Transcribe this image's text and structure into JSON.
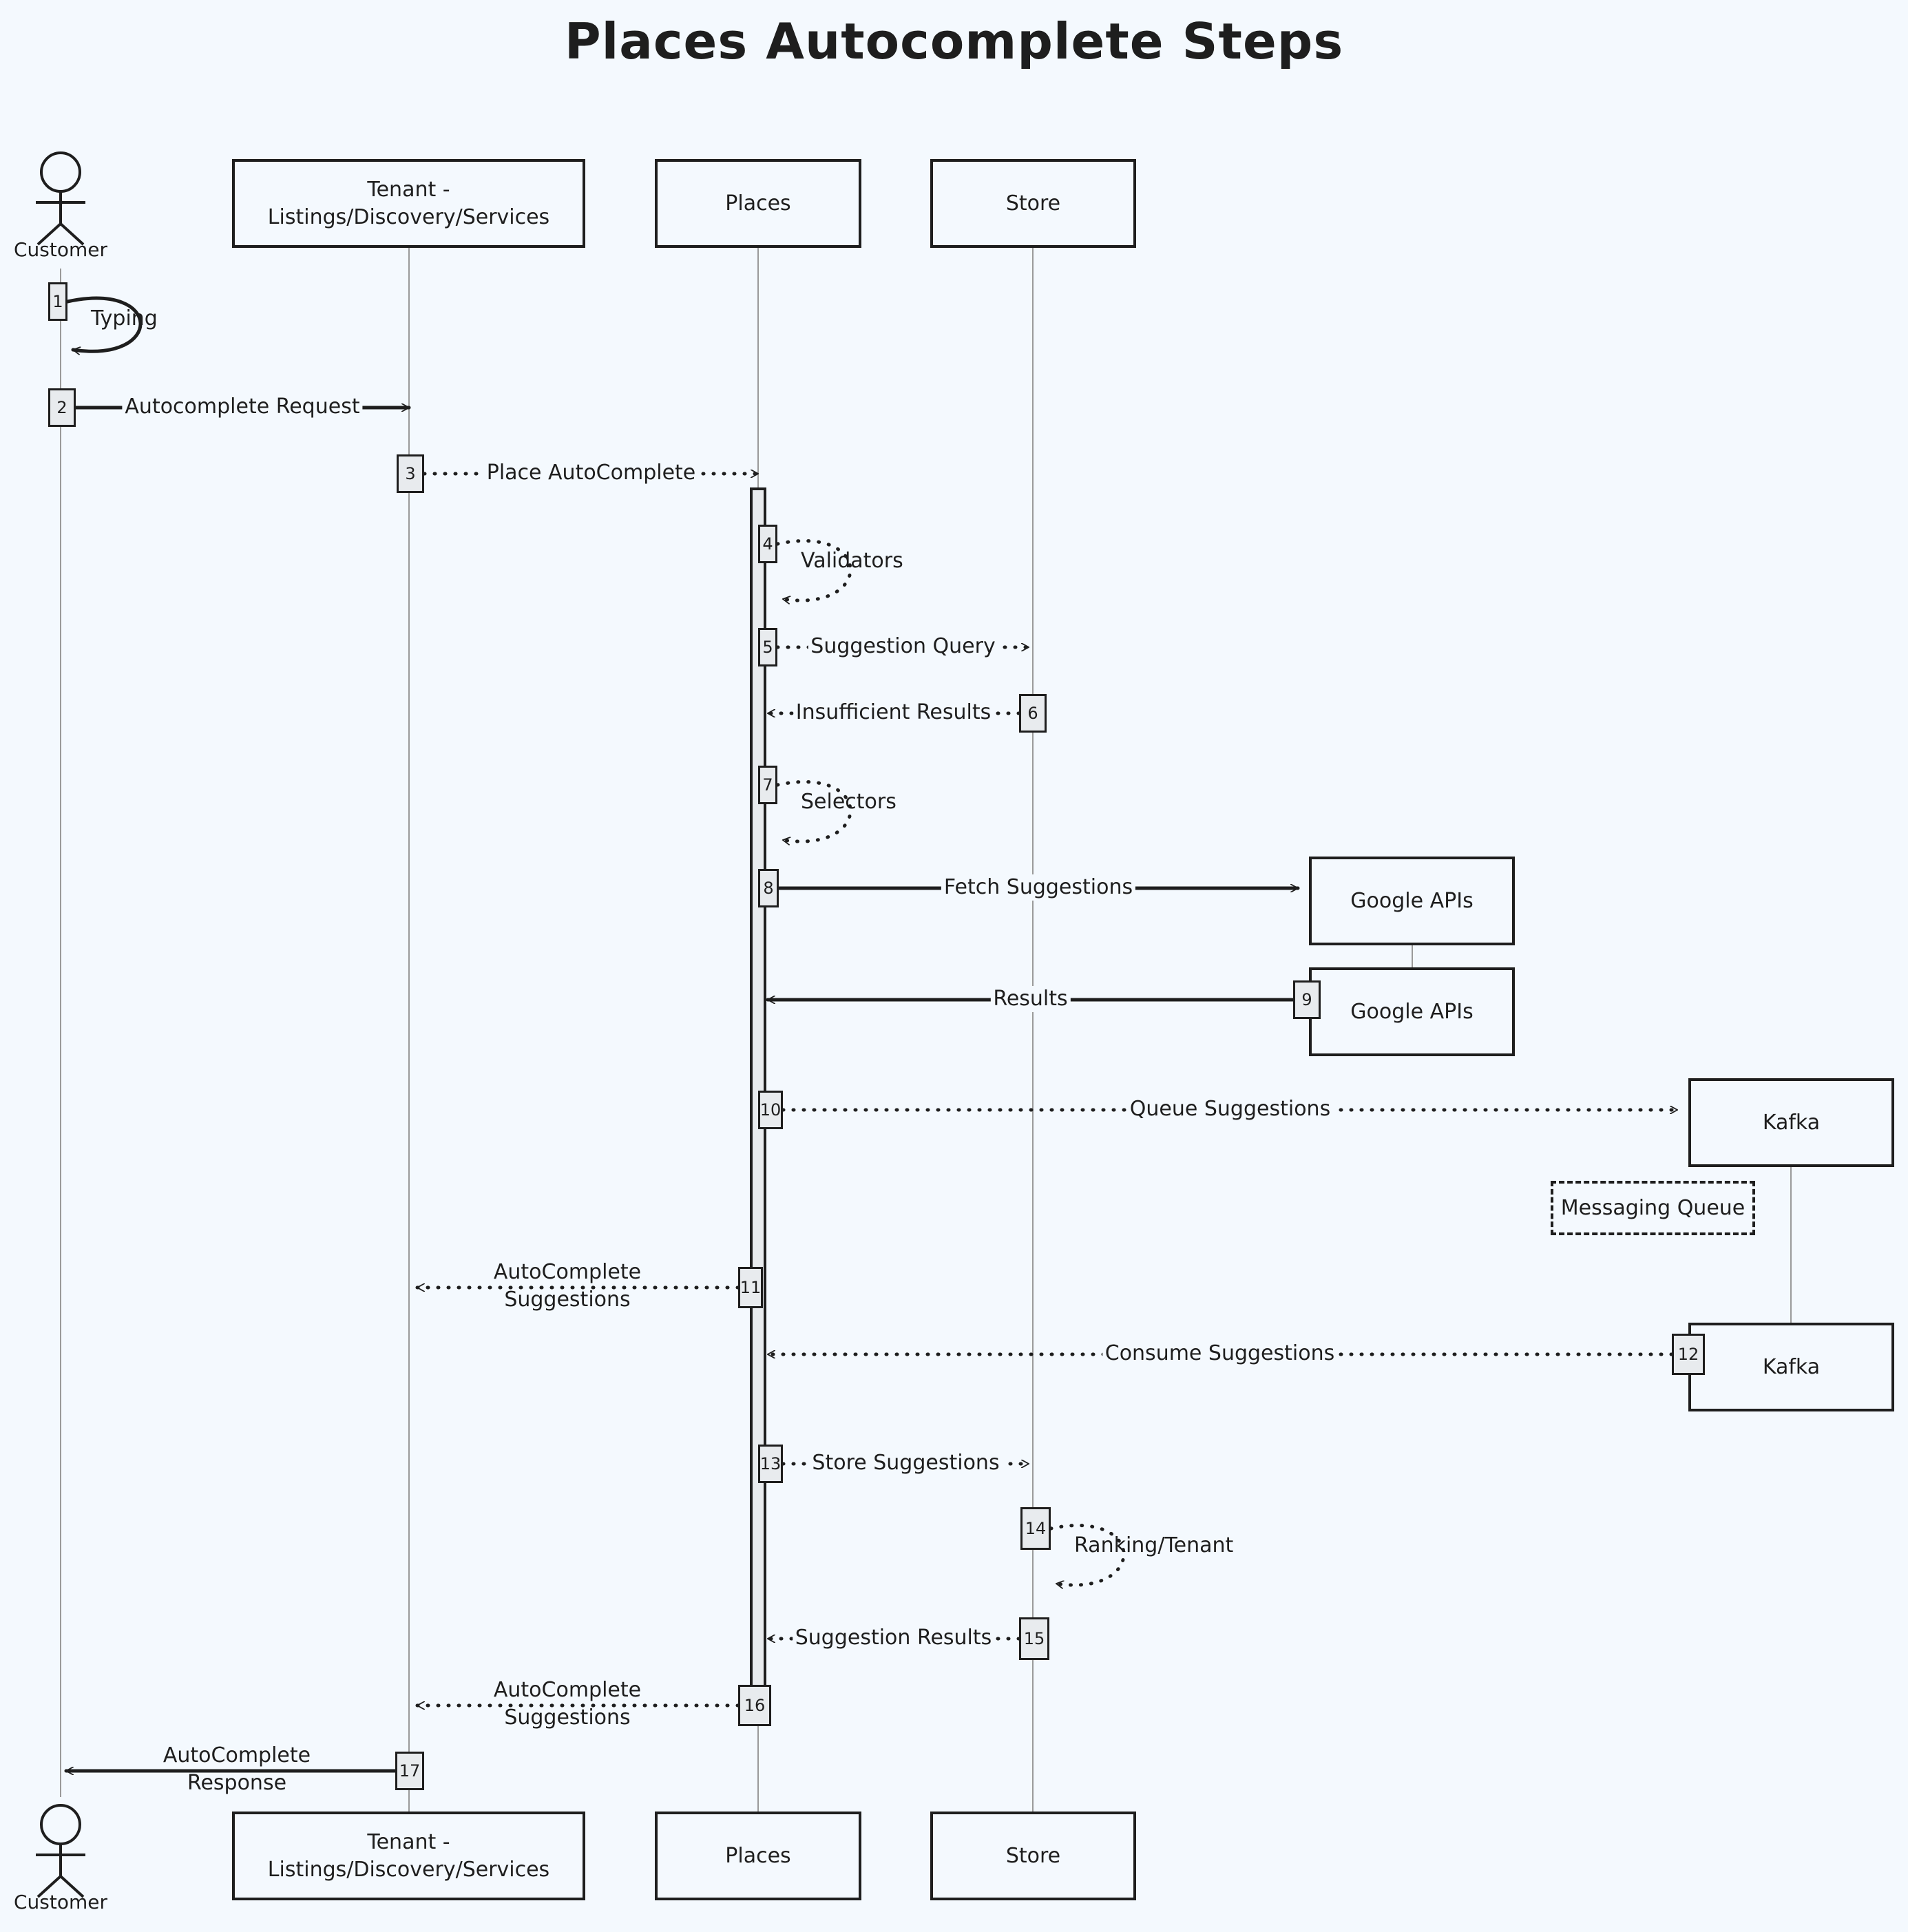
{
  "title": "Places Autocomplete Steps",
  "participants": {
    "customer": "Customer",
    "tenant": "Tenant - Listings/Discovery/Services",
    "places": "Places",
    "store": "Store",
    "google": "Google APIs",
    "kafka": "Kafka"
  },
  "note": "Messaging Queue",
  "messages": [
    {
      "n": "1",
      "from": "Customer",
      "to": "Customer",
      "label": "Typing",
      "style": "solid"
    },
    {
      "n": "2",
      "from": "Customer",
      "to": "Tenant",
      "label": "Autocomplete Request",
      "style": "solid"
    },
    {
      "n": "3",
      "from": "Tenant",
      "to": "Places",
      "label": "Place AutoComplete",
      "style": "dotted"
    },
    {
      "n": "4",
      "from": "Places",
      "to": "Places",
      "label": "Validators",
      "style": "dotted"
    },
    {
      "n": "5",
      "from": "Places",
      "to": "Store",
      "label": "Suggestion Query",
      "style": "dotted"
    },
    {
      "n": "6",
      "from": "Store",
      "to": "Places",
      "label": "Insufficient Results",
      "style": "dotted"
    },
    {
      "n": "7",
      "from": "Places",
      "to": "Places",
      "label": "Selectors",
      "style": "dotted"
    },
    {
      "n": "8",
      "from": "Places",
      "to": "Google APIs",
      "label": "Fetch Suggestions",
      "style": "solid"
    },
    {
      "n": "9",
      "from": "Google APIs",
      "to": "Places",
      "label": "Results",
      "style": "solid"
    },
    {
      "n": "10",
      "from": "Places",
      "to": "Kafka",
      "label": "Queue Suggestions",
      "style": "dotted"
    },
    {
      "n": "11",
      "from": "Places",
      "to": "Tenant",
      "label": "AutoComplete Suggestions",
      "style": "dotted"
    },
    {
      "n": "12",
      "from": "Kafka",
      "to": "Places",
      "label": "Consume Suggestions",
      "style": "dotted"
    },
    {
      "n": "13",
      "from": "Places",
      "to": "Store",
      "label": "Store Suggestions",
      "style": "dotted"
    },
    {
      "n": "14",
      "from": "Store",
      "to": "Store",
      "label": "Ranking/Tenant",
      "style": "dotted"
    },
    {
      "n": "15",
      "from": "Store",
      "to": "Places",
      "label": "Suggestion Results",
      "style": "dotted"
    },
    {
      "n": "16",
      "from": "Places",
      "to": "Tenant",
      "label": "AutoComplete Suggestions",
      "style": "dotted"
    },
    {
      "n": "17",
      "from": "Tenant",
      "to": "Customer",
      "label": "AutoComplete Response",
      "style": "solid"
    }
  ]
}
